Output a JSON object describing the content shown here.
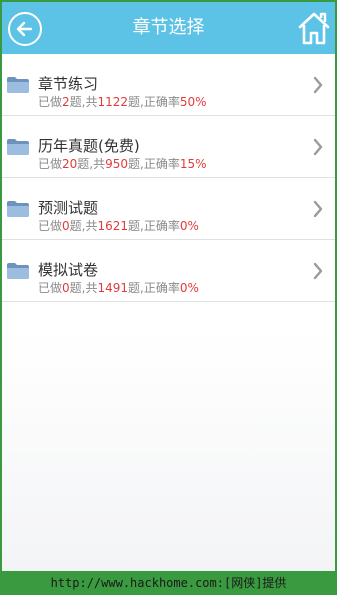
{
  "header": {
    "title": "章节选择",
    "back_icon": "back-arrow-circle-icon",
    "home_icon": "home-icon"
  },
  "items": [
    {
      "title": "章节练习",
      "done_prefix": "已做",
      "done": "2",
      "total_prefix": "题,共",
      "total": "1122",
      "rate_prefix": "题,正确率",
      "rate": "50%"
    },
    {
      "title": "历年真题(免费)",
      "done_prefix": "已做",
      "done": "20",
      "total_prefix": "题,共",
      "total": "950",
      "rate_prefix": "题,正确率",
      "rate": "15%"
    },
    {
      "title": "预测试题",
      "done_prefix": "已做",
      "done": "0",
      "total_prefix": "题,共",
      "total": "1621",
      "rate_prefix": "题,正确率",
      "rate": "0%"
    },
    {
      "title": "模拟试卷",
      "done_prefix": "已做",
      "done": "0",
      "total_prefix": "题,共",
      "total": "1491",
      "rate_prefix": "题,正确率",
      "rate": "0%"
    }
  ],
  "footer": {
    "text": "http://www.hackhome.com:[网侠]提供"
  },
  "colors": {
    "header": "#5cc2e6",
    "accent_red": "#e23b3b",
    "footer_green": "#3a9a3f"
  }
}
